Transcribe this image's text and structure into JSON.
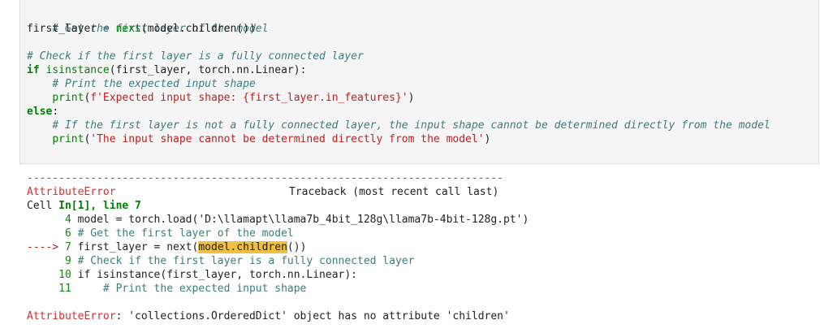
{
  "code_cell": {
    "lines": [
      [
        "# Get the first layer of the model"
      ],
      [
        "first_layer",
        " ",
        "=",
        " ",
        "next",
        "(model.children())"
      ],
      [
        ""
      ],
      [
        "# Check if the first layer is a fully connected layer"
      ],
      [
        "if",
        " ",
        "isinstance",
        "(first_layer, torch.nn.Linear):"
      ],
      [
        "    ",
        "# Print the expected input shape"
      ],
      [
        "    ",
        "print",
        "(",
        "f'Expected input shape: {first_layer.in_features}'",
        ")"
      ],
      [
        "else",
        ":"
      ],
      [
        "    ",
        "# If the first layer is not a fully connected layer, the input shape cannot be determined directly from the model"
      ],
      [
        "    ",
        "print",
        "(",
        "'The input shape cannot be determined directly from the model'",
        ")"
      ]
    ]
  },
  "traceback": {
    "separator": "---------------------------------------------------------------------------",
    "error_name": "AttributeError",
    "traceback_label": "Traceback (most recent call last)",
    "cell_ref_prefix": "Cell ",
    "cell_ref": "In[1], line 7",
    "lines": [
      {
        "prefix": "      ",
        "num": "4",
        "text": " model = torch.load('D:\\llamapt\\llama7b_4bit_128g\\llama7b-4bit-128g.pt')"
      },
      {
        "prefix": "      ",
        "num": "6",
        "text": " # Get the first layer of the model"
      },
      {
        "prefix": "----> ",
        "num": "7",
        "pre": " first_layer = next(",
        "hl": "model.children",
        "post": "())"
      },
      {
        "prefix": "      ",
        "num": "9",
        "text": " # Check if the first layer is a fully connected layer"
      },
      {
        "prefix": "     ",
        "num": "10",
        "text": " if isinstance(first_layer, torch.nn.Linear):"
      },
      {
        "prefix": "     ",
        "num": "11",
        "text": "     # Print the expected input shape"
      }
    ],
    "final_error_name": "AttributeError",
    "final_message": ": 'collections.OrderedDict' object has no attribute 'children'"
  },
  "colors": {
    "cell_bg": "#f5f5f5",
    "comment": "#3d7b7b",
    "keyword": "#008000",
    "string": "#ba2121",
    "error": "#d62e2e",
    "highlight": "#f0c040"
  }
}
